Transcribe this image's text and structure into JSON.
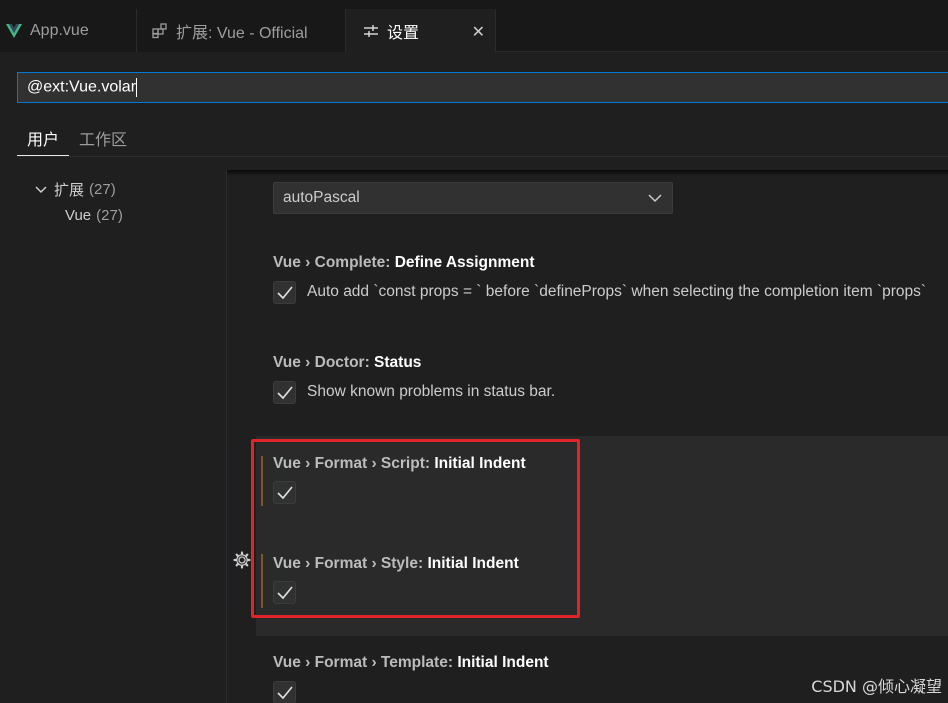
{
  "tabs": [
    {
      "label": "App.vue",
      "icon": "vue-logo-icon"
    },
    {
      "label": "扩展: Vue - Official",
      "icon": "extensions-icon"
    },
    {
      "label": "设置",
      "icon": "settings-sliders-icon",
      "close": "✕"
    }
  ],
  "search": {
    "value": "@ext:Vue.volar"
  },
  "scopes": {
    "user": "用户",
    "workspace": "工作区"
  },
  "toc": {
    "extensions": {
      "label": "扩展",
      "count": "(27)"
    },
    "vue": {
      "label": "Vue",
      "count": "(27)"
    }
  },
  "settings": {
    "dropdown_value": "autoPascal",
    "items": [
      {
        "category": "Vue › Complete: ",
        "name": "Define Assignment",
        "checked": true,
        "description": "Auto add `const props = ` before `defineProps` when selecting the completion item `props`"
      },
      {
        "category": "Vue › Doctor: ",
        "name": "Status",
        "checked": true,
        "description": "Show known problems in status bar."
      },
      {
        "category": "Vue › Format › Script: ",
        "name": "Initial Indent",
        "checked": true,
        "description": ""
      },
      {
        "category": "Vue › Format › Style: ",
        "name": "Initial Indent",
        "checked": true,
        "description": ""
      },
      {
        "category": "Vue › Format › Template: ",
        "name": "Initial Indent",
        "checked": true,
        "description": ""
      }
    ]
  },
  "watermark": "CSDN @倾心凝望",
  "colors": {
    "accent": "#0078d4",
    "vue_green": "#41b883",
    "highlight_box": "#e0242a",
    "modified_bar": "#7a5a22"
  }
}
